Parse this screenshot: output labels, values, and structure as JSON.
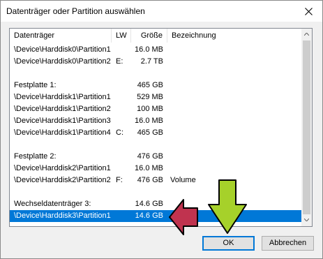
{
  "dialog": {
    "title": "Datenträger oder Partition auswählen"
  },
  "table": {
    "columns": {
      "device": "Datenträger",
      "drive_letter": "LW",
      "size": "Größe",
      "label": "Bezeichnung"
    },
    "rows": [
      {
        "device": "\\Device\\Harddisk0\\Partition1",
        "drive_letter": "",
        "size": "16.0 MB",
        "label": ""
      },
      {
        "device": "\\Device\\Harddisk0\\Partition2",
        "drive_letter": "E:",
        "size": "2.7 TB",
        "label": ""
      },
      {
        "device": "",
        "drive_letter": "",
        "size": "",
        "label": ""
      },
      {
        "device": "Festplatte 1:",
        "drive_letter": "",
        "size": "465 GB",
        "label": ""
      },
      {
        "device": "\\Device\\Harddisk1\\Partition1",
        "drive_letter": "",
        "size": "529 MB",
        "label": ""
      },
      {
        "device": "\\Device\\Harddisk1\\Partition2",
        "drive_letter": "",
        "size": "100 MB",
        "label": ""
      },
      {
        "device": "\\Device\\Harddisk1\\Partition3",
        "drive_letter": "",
        "size": "16.0 MB",
        "label": ""
      },
      {
        "device": "\\Device\\Harddisk1\\Partition4",
        "drive_letter": "C:",
        "size": "465 GB",
        "label": ""
      },
      {
        "device": "",
        "drive_letter": "",
        "size": "",
        "label": ""
      },
      {
        "device": "Festplatte 2:",
        "drive_letter": "",
        "size": "476 GB",
        "label": ""
      },
      {
        "device": "\\Device\\Harddisk2\\Partition1",
        "drive_letter": "",
        "size": "16.0 MB",
        "label": ""
      },
      {
        "device": "\\Device\\Harddisk2\\Partition2",
        "drive_letter": "F:",
        "size": "476 GB",
        "label": "Volume"
      },
      {
        "device": "",
        "drive_letter": "",
        "size": "",
        "label": ""
      },
      {
        "device": "Wechseldatenträger 3:",
        "drive_letter": "",
        "size": "14.6 GB",
        "label": ""
      },
      {
        "device": "\\Device\\Harddisk3\\Partition1",
        "drive_letter": "",
        "size": "14.6 GB",
        "label": "",
        "selected": true
      }
    ]
  },
  "buttons": {
    "ok": "OK",
    "cancel": "Abbrechen"
  },
  "annotations": {
    "red_arrow_color": "#c0334f",
    "green_arrow_color": "#a6d12a"
  },
  "icons": {
    "close": "close-icon",
    "scroll_up": "scroll-up-arrow-icon",
    "scroll_down": "scroll-down-arrow-icon"
  }
}
